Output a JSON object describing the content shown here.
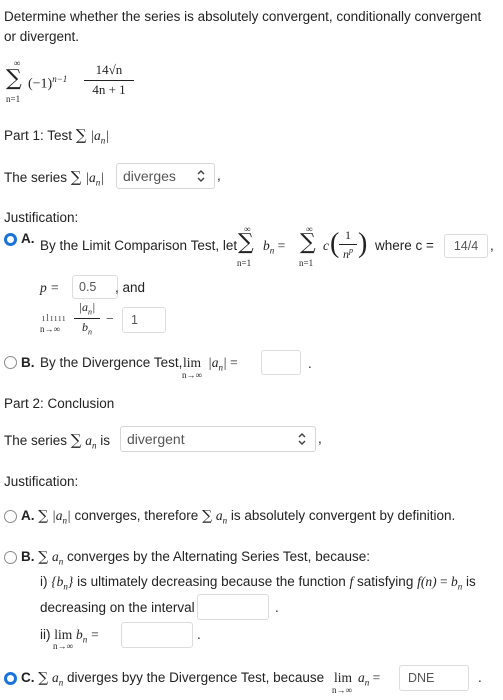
{
  "question": {
    "instruction": "Determine whether the series is absolutely convergent, conditionally convergent or divergent.",
    "series_sum_upper": "∞",
    "series_sum_lower": "n=1",
    "series_sign": "(−1)",
    "series_sign_exp": "n−1",
    "series_num": "14√n",
    "series_den": "4n + 1"
  },
  "part1": {
    "title_prefix": "Part 1: Test",
    "title_term": "|a",
    "title_sub": "n",
    "title_end": "|",
    "series_text": "The series",
    "dropdown_value": "diverges",
    "justification_label": "Justification:",
    "optA_letter": "A.",
    "optA_text": "By the Limit Comparison Test, let",
    "optA_where": "where c =",
    "c_value": "14/4",
    "p_label": "p =",
    "p_value": "0.5",
    "and_text": ", and",
    "lim_label": "lim",
    "lim_sub": "n→∞",
    "ratio_value": "1",
    "optB_letter": "B.",
    "optB_text": "By the Divergence Test,",
    "optB_value": "",
    "period": "."
  },
  "part2": {
    "title": "Part 2: Conclusion",
    "series_text": "The series",
    "is_text": "is",
    "dropdown_value": "divergent",
    "justification_label": "Justification:",
    "optA_letter": "A.",
    "optA_text1": "converges, therefore",
    "optA_text2": "is absolutely convergent by definition.",
    "optB_letter": "B.",
    "optB_text": "converges by the Alternating Series Test, because:",
    "optB_i_prefix": "i)",
    "optB_i_text1": "is ultimately decreasing because the function",
    "optB_i_text2": "satisfying",
    "optB_i_text3": "is",
    "optB_i_text4": "decreasing on the interval",
    "optB_interval_value": "",
    "optB_ii_prefix": "ii)",
    "optB_ii_value": "",
    "optC_letter": "C.",
    "optC_text": "diverges byy the Divergence Test, because",
    "optC_value": "DNE"
  },
  "colors": {
    "accent": "#1a73d9",
    "border": "#dcdcdc"
  },
  "selected": {
    "part1": "A",
    "part2": "C"
  }
}
